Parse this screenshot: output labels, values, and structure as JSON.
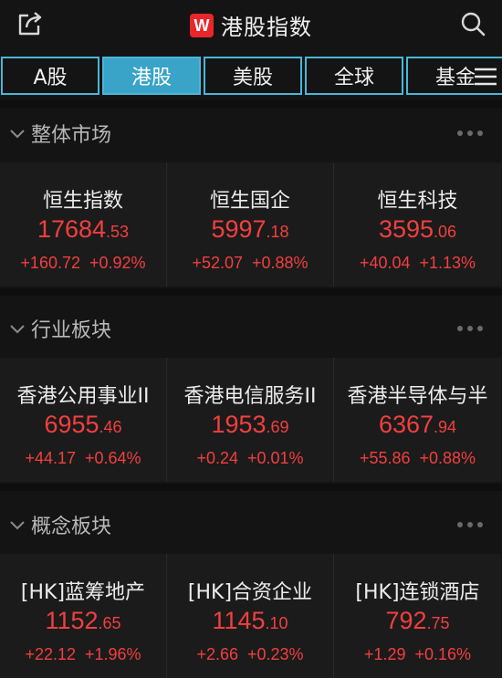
{
  "header": {
    "title": "港股指数",
    "logo_text": "W",
    "icons": [
      "share-icon",
      "search-icon"
    ]
  },
  "tabs": [
    {
      "label": "A股",
      "active": false
    },
    {
      "label": "港股",
      "active": true
    },
    {
      "label": "美股",
      "active": false
    },
    {
      "label": "全球",
      "active": false
    },
    {
      "label": "基金",
      "active": false
    }
  ],
  "sections": [
    {
      "title": "整体市场",
      "cards": [
        {
          "name": "恒生指数",
          "price_int": "17684",
          "price_dec": ".53",
          "change": "+160.72",
          "change_pct": "+0.92%"
        },
        {
          "name": "恒生国企",
          "price_int": "5997",
          "price_dec": ".18",
          "change": "+52.07",
          "change_pct": "+0.88%"
        },
        {
          "name": "恒生科技",
          "price_int": "3595",
          "price_dec": ".06",
          "change": "+40.04",
          "change_pct": "+1.13%"
        }
      ]
    },
    {
      "title": "行业板块",
      "cards": [
        {
          "name": "香港公用事业II",
          "price_int": "6955",
          "price_dec": ".46",
          "change": "+44.17",
          "change_pct": "+0.64%"
        },
        {
          "name": "香港电信服务II",
          "price_int": "1953",
          "price_dec": ".69",
          "change": "+0.24",
          "change_pct": "+0.01%"
        },
        {
          "name": "香港半导体与半",
          "price_int": "6367",
          "price_dec": ".94",
          "change": "+55.86",
          "change_pct": "+0.88%"
        }
      ]
    },
    {
      "title": "概念板块",
      "cards": [
        {
          "name": "[HK]蓝筹地产",
          "price_int": "1152",
          "price_dec": ".65",
          "change": "+22.12",
          "change_pct": "+1.96%"
        },
        {
          "name": "[HK]合资企业",
          "price_int": "1145",
          "price_dec": ".10",
          "change": "+2.66",
          "change_pct": "+0.23%"
        },
        {
          "name": "[HK]连锁酒店",
          "price_int": "792",
          "price_dec": ".75",
          "change": "+1.29",
          "change_pct": "+0.16%"
        }
      ]
    }
  ],
  "colors": {
    "up": "#f33f3f",
    "accent": "#39a3c8",
    "background": "#141414"
  }
}
